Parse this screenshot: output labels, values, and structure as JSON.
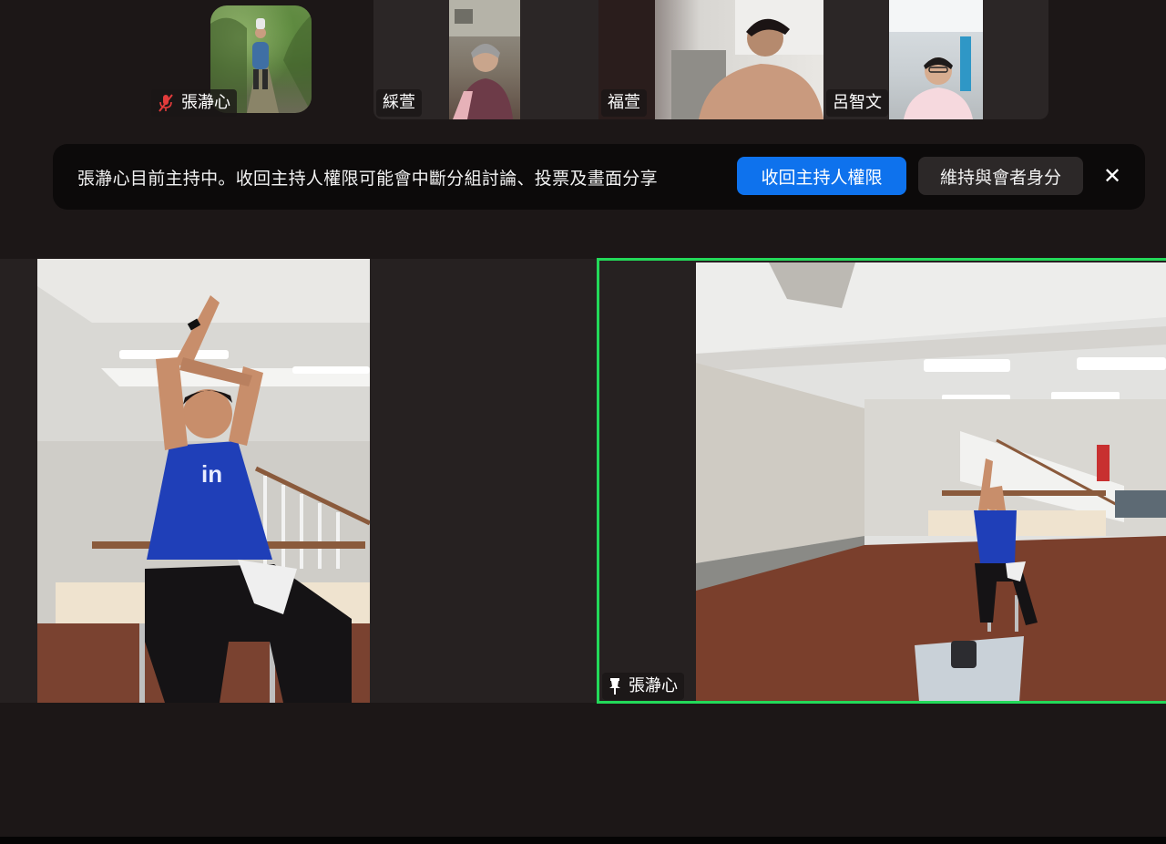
{
  "participants_strip": [
    {
      "name": "張瀞心",
      "muted": true
    },
    {
      "name": "綵萱",
      "muted": false
    },
    {
      "name": "福萱",
      "muted": false
    },
    {
      "name": "呂智文",
      "muted": false
    }
  ],
  "banner": {
    "message": "張瀞心目前主持中。收回主持人權限可能會中斷分組討論、投票及畫面分享",
    "primary_label": "收回主持人權限",
    "secondary_label": "維持與會者身分",
    "close_glyph": "✕"
  },
  "main_tiles": [
    {
      "name": "",
      "pinned": false
    },
    {
      "name": "張瀞心",
      "pinned": true
    }
  ],
  "colors": {
    "background": "#1c1717",
    "banner_bg": "#0c0a0a",
    "primary_button": "#0e72ed",
    "active_speaker_border": "#23d959",
    "mute_icon": "#e23b3b"
  },
  "icons": {
    "mute": "microphone-off-icon",
    "pin": "pin-icon",
    "close": "close-icon"
  }
}
